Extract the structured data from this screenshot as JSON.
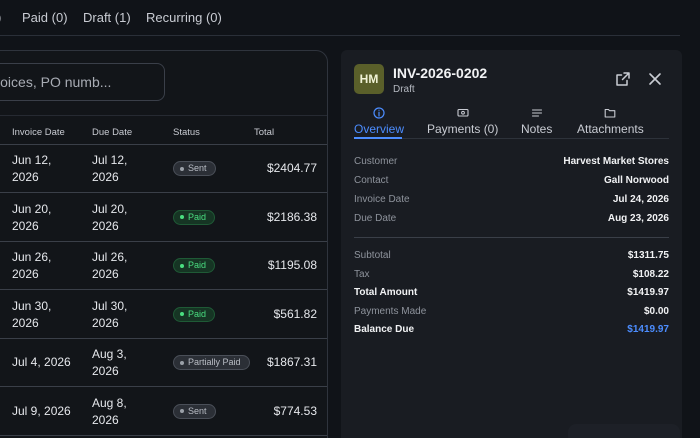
{
  "top_tabs": [
    "Paid (0)",
    "Draft (1)",
    "Recurring (0)"
  ],
  "search": {
    "placeholder": "Search invoices, PO numb..."
  },
  "table": {
    "headers": [
      "Invoice Date",
      "Due Date",
      "Status",
      "Total"
    ],
    "rows": [
      {
        "invoice_date": [
          "Jun 12,",
          "2026"
        ],
        "due_date": [
          "Jul 12,",
          "2026"
        ],
        "status": "Sent",
        "status_kind": "sent",
        "total": "$2404.77"
      },
      {
        "invoice_date": [
          "Jun 20,",
          "2026"
        ],
        "due_date": [
          "Jul 20,",
          "2026"
        ],
        "status": "Paid",
        "status_kind": "paid",
        "total": "$2186.38"
      },
      {
        "invoice_date": [
          "Jun 26,",
          "2026"
        ],
        "due_date": [
          "Jul 26,",
          "2026"
        ],
        "status": "Paid",
        "status_kind": "paid",
        "total": "$1195.08"
      },
      {
        "invoice_date": [
          "Jun 30,",
          "2026"
        ],
        "due_date": [
          "Jul 30,",
          "2026"
        ],
        "status": "Paid",
        "status_kind": "paid",
        "total": "$561.82"
      },
      {
        "invoice_date": [
          "Jul 4, 2026"
        ],
        "due_date": [
          "Aug 3,",
          "2026"
        ],
        "status": "Partially Paid",
        "status_kind": "partial",
        "total": "$1867.31"
      },
      {
        "invoice_date": [
          "Jul 9, 2026"
        ],
        "due_date": [
          "Aug 8,",
          "2026"
        ],
        "status": "Sent",
        "status_kind": "sent",
        "total": "$774.53"
      }
    ]
  },
  "detail": {
    "avatar": "HM",
    "title": "INV-2026-0202",
    "status": "Draft",
    "tabs": [
      "Overview",
      "Payments (0)",
      "Notes",
      "Attachments"
    ],
    "active_tab": 0,
    "info": [
      {
        "label": "Customer",
        "value": "Harvest Market Stores"
      },
      {
        "label": "Contact",
        "value": "Gall Norwood"
      },
      {
        "label": "Invoice Date",
        "value": "Jul 24, 2026"
      },
      {
        "label": "Due Date",
        "value": "Aug 23, 2026"
      }
    ],
    "amounts": [
      {
        "label": "Subtotal",
        "value": "$1311.75"
      },
      {
        "label": "Tax",
        "value": "$108.22"
      },
      {
        "label": "Total Amount",
        "value": "$1419.97",
        "strong": true
      },
      {
        "label": "Payments Made",
        "value": "$0.00"
      },
      {
        "label": "Balance Due",
        "value": "$1419.97",
        "strong": true,
        "accent": true
      }
    ]
  },
  "colors": {
    "accent": "#4c8dff",
    "paid": "#4ade80",
    "background": "#101318",
    "panel": "#191c22"
  }
}
